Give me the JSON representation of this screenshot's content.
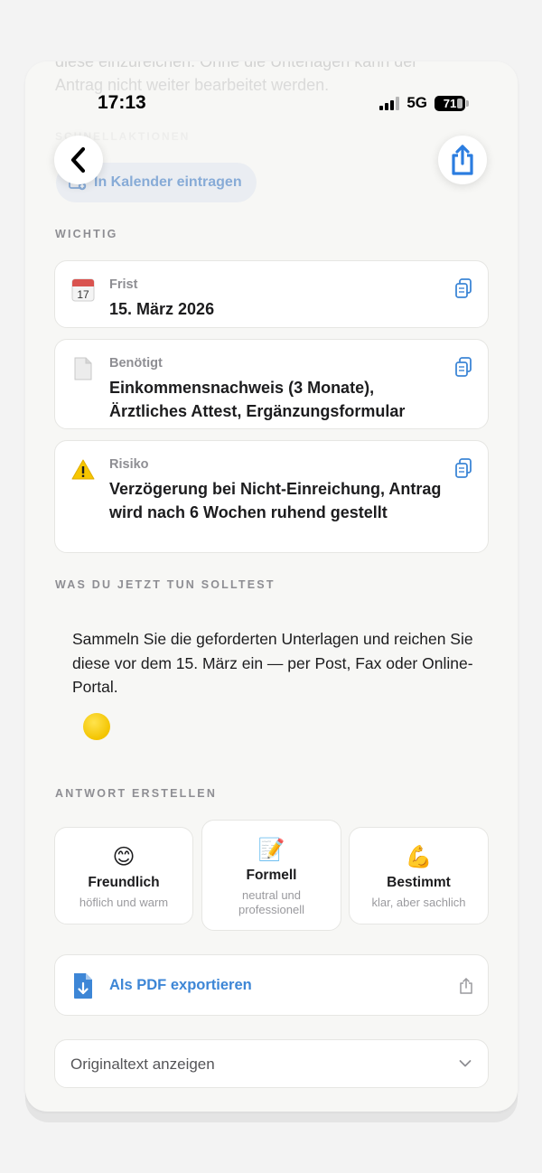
{
  "status_bar": {
    "time": "17:13",
    "network": "5G",
    "battery": "71"
  },
  "scrolled_text": {
    "line1": "diese einzureichen. Ohne die Unterlagen kann der",
    "line2": "Antrag nicht weiter bearbeitet werden.",
    "quick_actions_title": "SCHNELLAKTIONEN"
  },
  "quick_action": {
    "calendar_label": "In Kalender eintragen"
  },
  "important": {
    "title": "WICHTIG",
    "items": [
      {
        "label": "Frist",
        "value": "15. März 2026",
        "icon": "calendar-icon"
      },
      {
        "label": "Benötigt",
        "value": "Einkommensnachweis (3 Monate), Ärztliches Attest, Ergänzungsformular",
        "icon": "document-icon"
      },
      {
        "label": "Risiko",
        "value": "Verzögerung bei Nicht-Einreichung, Antrag wird nach 6 Wochen ruhend gestellt",
        "icon": "warning-icon"
      }
    ]
  },
  "todo": {
    "title": "WAS DU JETZT TUN SOLLTEST",
    "text": "Sammeln Sie die geforderten Unterlagen und reichen Sie diese vor dem 15. März ein — per Post, Fax oder Online-Portal."
  },
  "reply": {
    "title": "ANTWORT ERSTELLEN",
    "tones": [
      {
        "emoji": "😊",
        "name": "Freundlich",
        "desc": "höflich und warm"
      },
      {
        "emoji": "📝",
        "name": "Formell",
        "desc": "neutral und professionell"
      },
      {
        "emoji": "💪",
        "name": "Bestimmt",
        "desc": "klar, aber sachlich"
      }
    ]
  },
  "export": {
    "pdf_label": "Als PDF exportieren"
  },
  "original": {
    "label": "Originaltext anzeigen"
  },
  "colors": {
    "accent": "#3d86d6",
    "background": "#f7f7f5",
    "card": "#ffffff",
    "muted": "#8e8e93"
  }
}
